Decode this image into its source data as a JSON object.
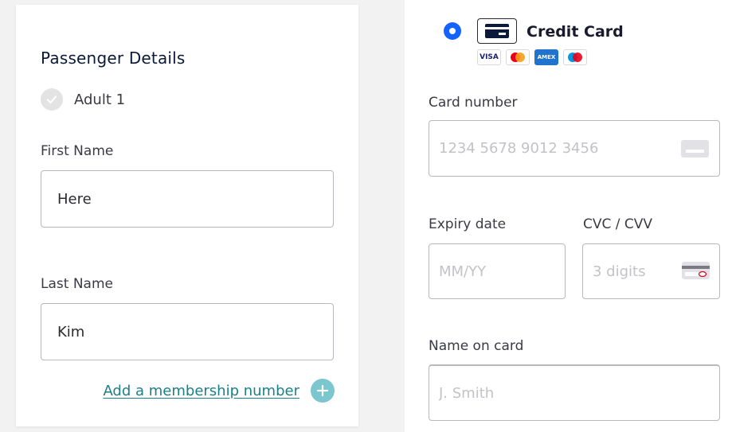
{
  "passenger": {
    "section_title": "Passenger Details",
    "traveler_label": "Adult 1",
    "first_name_label": "First Name",
    "first_name_value": "Here",
    "last_name_label": "Last Name",
    "last_name_value": "Kim",
    "membership_link": "Add a membership number"
  },
  "payment": {
    "method_title": "Credit Card",
    "method_selected": true,
    "brands": [
      "VISA",
      "mastercard",
      "AMEX",
      "maestro"
    ],
    "card_number_label": "Card number",
    "card_number_placeholder": "1234 5678 9012 3456",
    "expiry_label": "Expiry date",
    "expiry_placeholder": "MM/YY",
    "cvc_label": "CVC / CVV",
    "cvc_placeholder": "3 digits",
    "name_label": "Name on card",
    "name_placeholder": "J. Smith"
  },
  "colors": {
    "accent": "#1463ff",
    "link": "#1b7f88",
    "plus_button": "#7cc6cf"
  }
}
